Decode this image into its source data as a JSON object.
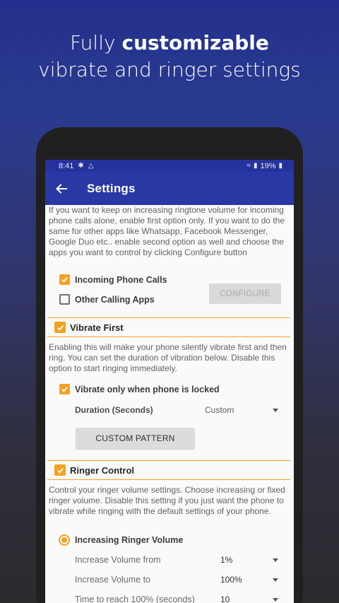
{
  "headline": {
    "line1_prefix": "Fully ",
    "line1_bold": "customizable",
    "line2": "vibrate and ringer settings"
  },
  "statusbar": {
    "time": "8:41",
    "battery": "19%"
  },
  "appbar": {
    "title": "Settings"
  },
  "intro_text": "If you want to keep on increasing ringtone volume for incoming phone calls alone, enable first option only. If you want to do the same for other apps like Whatsapp, Facebook Messenger, Google Duo etc.. enable second option as well and choose the apps you want to control by clicking Configure button",
  "options": {
    "incoming_calls": {
      "label": "Incoming Phone Calls",
      "checked": true
    },
    "other_apps": {
      "label": "Other Calling Apps",
      "checked": false
    },
    "configure_label": "CONFIGURE"
  },
  "vibrate": {
    "title": "Vibrate First",
    "enabled": true,
    "description": "Enabling this will make your phone silently vibrate first and then ring. You can set the duration of vibration below. Disable this option to start ringing immediately.",
    "locked_only": {
      "label": "Vibrate only when phone is locked",
      "checked": true
    },
    "duration_label": "Duration (Seconds)",
    "duration_value": "Custom",
    "pattern_button": "CUSTOM PATTERN"
  },
  "ringer": {
    "title": "Ringer Control",
    "enabled": true,
    "description": "Control your ringer volume settings. Choose increasing or fixed ringer volume. Disable this setting if you just want the phone to vibrate while ringing with the default settings of your phone.",
    "mode_label": "Increasing Ringer Volume",
    "rows": [
      {
        "label": "Increase Volume from",
        "value": "1%"
      },
      {
        "label": "Increase Volume to",
        "value": "100%"
      },
      {
        "label": "Time to reach 100% (seconds)",
        "value": "10"
      }
    ]
  },
  "colors": {
    "accent": "#f5a120",
    "appbar": "#2a38a6",
    "statusbar": "#26329b"
  }
}
